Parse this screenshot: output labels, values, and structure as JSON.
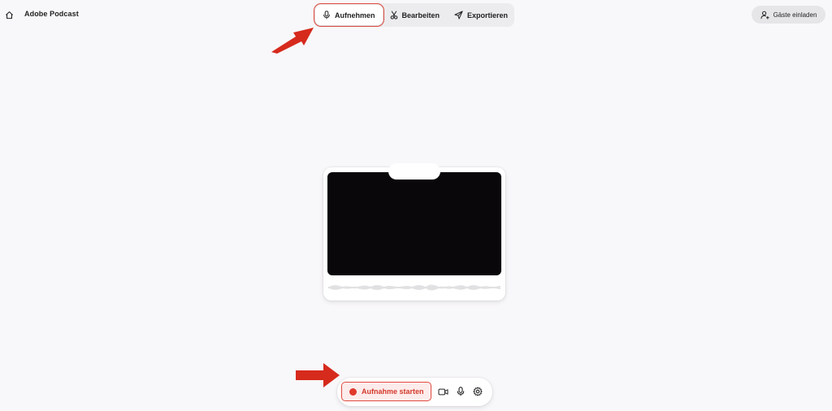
{
  "app": {
    "title": "Adobe Podcast"
  },
  "modes": [
    {
      "label": "Aufnehmen",
      "icon": "microphone-icon",
      "active": true
    },
    {
      "label": "Bearbeiten",
      "icon": "scissors-icon",
      "active": false
    },
    {
      "label": "Exportieren",
      "icon": "send-icon",
      "active": false
    }
  ],
  "invite": {
    "label": "Gäste einladen",
    "icon": "add-user-icon"
  },
  "controls": {
    "record_label": "Aufnahme starten",
    "icons": [
      "camera-icon",
      "microphone-icon",
      "settings-icon"
    ]
  },
  "colors": {
    "accent": "#e04a3f",
    "record_text": "#d4392c",
    "record_bg": "#fdeceb",
    "annotation_arrow": "#d62a1c",
    "video_bg": "#09070a",
    "page_bg": "#f8f7f9"
  }
}
